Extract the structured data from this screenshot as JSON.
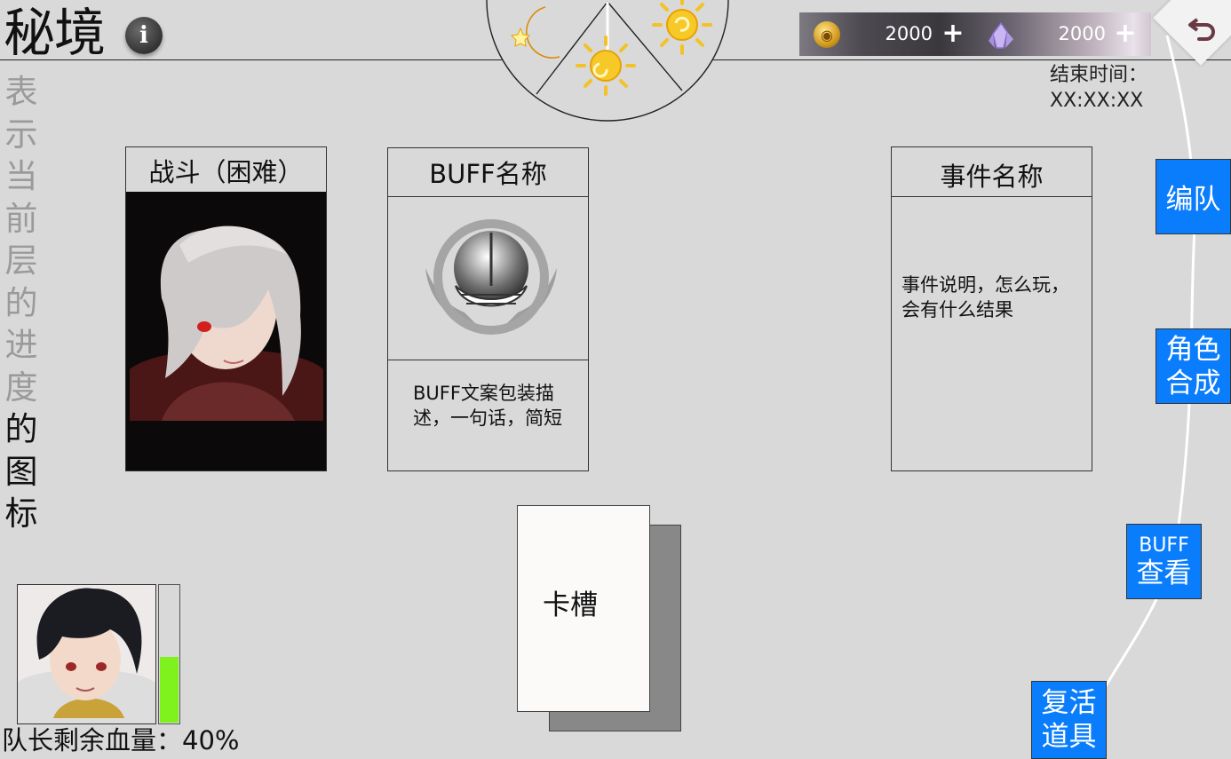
{
  "header": {
    "title": "秘境",
    "info_icon": "i"
  },
  "progress": {
    "chars": [
      {
        "c": "表",
        "dim": true
      },
      {
        "c": "示",
        "dim": true
      },
      {
        "c": "当",
        "dim": true
      },
      {
        "c": "前",
        "dim": true
      },
      {
        "c": "层",
        "dim": true
      },
      {
        "c": "的",
        "dim": true
      },
      {
        "c": "进",
        "dim": true
      },
      {
        "c": "度",
        "dim": true
      },
      {
        "c": "的",
        "dim": false
      },
      {
        "c": "图",
        "dim": false
      },
      {
        "c": "标",
        "dim": false
      }
    ]
  },
  "currency": {
    "coin_value": "2000",
    "crystal_value": "2000",
    "plus": "+"
  },
  "end_time": {
    "label": "结束时间：",
    "value": "XX:XX:XX"
  },
  "cards": {
    "battle_title": "战斗（困难）",
    "buff_title": "BUFF名称",
    "buff_desc": "BUFF文案包装描述，一句话，简短",
    "event_title": "事件名称",
    "event_desc": "事件说明，怎么玩，会有什么结果"
  },
  "slot": {
    "label": "卡槽"
  },
  "leader": {
    "hp_label": "队长剩余血量：40%",
    "hp_fraction": 0.48
  },
  "menu": {
    "team": "编队",
    "synth_line1": "角色",
    "synth_line2": "合成",
    "buff_line1": "BUFF",
    "buff_line2": "查看",
    "revive_line1": "复活",
    "revive_line2": "道具"
  },
  "colors": {
    "menu_blue": "#0a7dfc",
    "hp_green": "#7ff21e",
    "background": "#d9d9d9"
  }
}
